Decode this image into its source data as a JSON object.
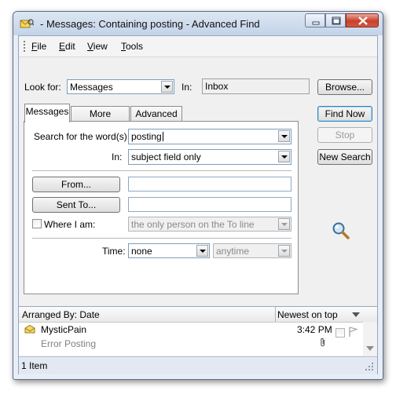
{
  "window": {
    "title": "- Messages: Containing posting - Advanced Find"
  },
  "menu": {
    "file": "File",
    "edit": "Edit",
    "view": "View",
    "tools": "Tools"
  },
  "look_for": {
    "label": "Look for:",
    "value": "Messages",
    "in_label": "In:",
    "in_value": "Inbox"
  },
  "buttons": {
    "browse": "Browse...",
    "find_now": "Find Now",
    "stop": "Stop",
    "new_search": "New Search"
  },
  "tabs": [
    "Messages",
    "More Choices",
    "Advanced"
  ],
  "messages_tab": {
    "search_words_label": "Search for the word(s):",
    "search_words_value": "posting",
    "in_label": "In:",
    "in_value": "subject field only",
    "from_button": "From...",
    "from_value": "",
    "sent_to_button": "Sent To...",
    "sent_to_value": "",
    "where_i_am_label": "Where I am:",
    "where_i_am_checked": false,
    "where_i_am_value": "the only person on the To line",
    "time_label": "Time:",
    "time_value": "none",
    "time_range_value": "anytime"
  },
  "results": {
    "arranged_by": "Arranged By: Date",
    "sort_order": "Newest on top",
    "items": [
      {
        "sender": "MysticPain",
        "subject": "Error Posting",
        "time": "3:42 PM"
      }
    ]
  },
  "status": {
    "count": "1 Item"
  },
  "colors": {
    "accent": "#3c7fb1",
    "close_button": "#c8402c",
    "dim_text": "#808080"
  },
  "icons": [
    "app-icon",
    "minimize-icon",
    "maximize-icon",
    "close-icon",
    "magnifier-icon",
    "envelope-icon",
    "attachment-icon",
    "flag-icon",
    "resize-grip-icon"
  ]
}
